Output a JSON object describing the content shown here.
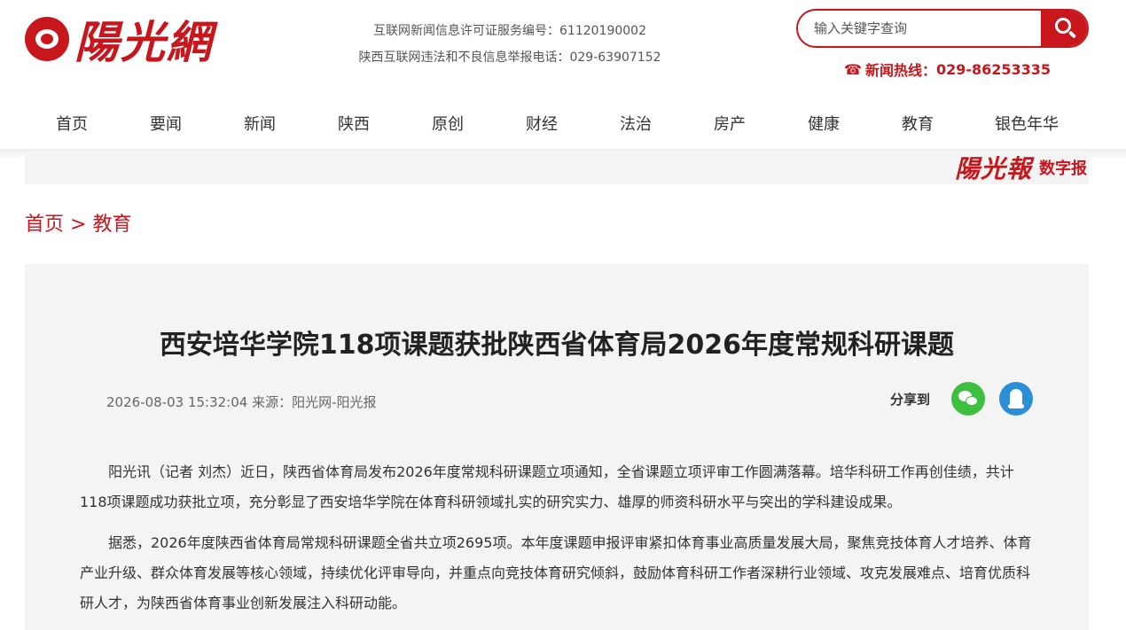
{
  "site": {
    "logo_text": "陽光網",
    "license_line1": "互联网新闻信息许可证服务编号：61120190002",
    "license_line2": "陕西互联网违法和不良信息举报电话：029-63907152",
    "search_placeholder": "输入关键字查询",
    "hotline_label": "新闻热线：",
    "hotline_number": "029-86253335",
    "brand_color": "#c8161d"
  },
  "nav": {
    "items": [
      {
        "label": "首页"
      },
      {
        "label": "要闻"
      },
      {
        "label": "新闻"
      },
      {
        "label": "陕西"
      },
      {
        "label": "原创"
      },
      {
        "label": "财经"
      },
      {
        "label": "法治"
      },
      {
        "label": "房产"
      },
      {
        "label": "健康"
      },
      {
        "label": "教育"
      },
      {
        "label": "银色年华"
      }
    ]
  },
  "banner": {
    "logo_text": "陽光報",
    "label": "数字报"
  },
  "breadcrumb": {
    "home": "首页",
    "separator": ">",
    "current": "教育"
  },
  "article": {
    "title": "西安培华学院118项课题获批陕西省体育局2026年度常规科研课题",
    "meta": "2026-08-03 15:32:04 来源：阳光网-阳光报",
    "share_label": "分享到",
    "paragraphs": [
      "阳光讯（记者 刘杰）近日，陕西省体育局发布2026年度常规科研课题立项通知，全省课题立项评审工作圆满落幕。培华科研工作再创佳绩，共计118项课题成功获批立项，充分彰显了西安培华学院在体育科研领域扎实的研究实力、雄厚的师资科研水平与突出的学科建设成果。",
      "据悉，2026年度陕西省体育局常规科研课题全省共立项2695项。本年度课题申报评审紧扣体育事业高质量发展大局，聚焦竞技体育人才培养、体育产业升级、群众体育发展等核心领域，持续优化评审导向，并重点向竞技体育研究倾斜，鼓励体育科研工作者深耕行业领域、攻克发展难点、培育优质科研人才，为陕西省体育事业创新发展注入科研动能。"
    ]
  }
}
